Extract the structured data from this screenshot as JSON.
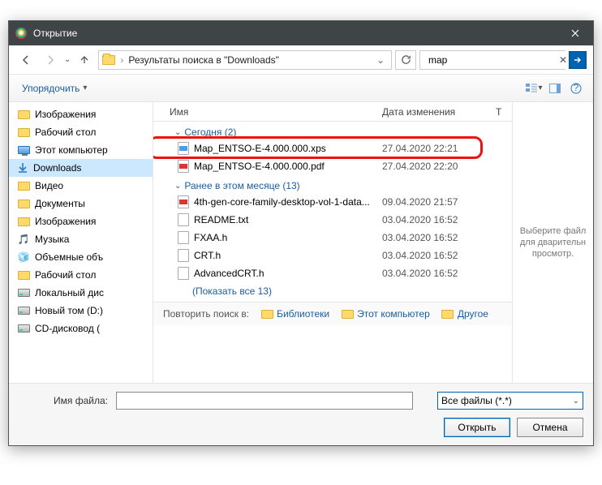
{
  "title": "Открытие",
  "breadcrumb": "Результаты поиска в \"Downloads\"",
  "search": {
    "value": "map"
  },
  "toolbar": {
    "organize": "Упорядочить"
  },
  "columns": {
    "name": "Имя",
    "date": "Дата изменения",
    "t": "Т"
  },
  "sidebar": {
    "items": [
      {
        "label": "Изображения",
        "icon": "folder"
      },
      {
        "label": "Рабочий стол",
        "icon": "folder"
      },
      {
        "label": "Этот компьютер",
        "icon": "pc"
      },
      {
        "label": "Downloads",
        "icon": "download",
        "selected": true
      },
      {
        "label": "Видео",
        "icon": "folder"
      },
      {
        "label": "Документы",
        "icon": "folder"
      },
      {
        "label": "Изображения",
        "icon": "folder"
      },
      {
        "label": "Музыка",
        "icon": "music"
      },
      {
        "label": "Объемные объ",
        "icon": "cube"
      },
      {
        "label": "Рабочий стол",
        "icon": "folder"
      },
      {
        "label": "Локальный дис",
        "icon": "disk"
      },
      {
        "label": "Новый том (D:)",
        "icon": "disk"
      },
      {
        "label": "CD-дисковод (",
        "icon": "disk"
      }
    ]
  },
  "groups": [
    {
      "label": "Сегодня (2)",
      "files": [
        {
          "name": "Map_ENTSO-E-4.000.000.xps",
          "date": "27.04.2020 22:21",
          "type": "xps",
          "highlight": true
        },
        {
          "name": "Map_ENTSO-E-4.000.000.pdf",
          "date": "27.04.2020 22:20",
          "type": "pdf"
        }
      ]
    },
    {
      "label": "Ранее в этом месяце (13)",
      "files": [
        {
          "name": "4th-gen-core-family-desktop-vol-1-data...",
          "date": "09.04.2020 21:57",
          "type": "pdf"
        },
        {
          "name": "README.txt",
          "date": "03.04.2020 16:52",
          "type": "txt"
        },
        {
          "name": "FXAA.h",
          "date": "03.04.2020 16:52",
          "type": "txt"
        },
        {
          "name": "CRT.h",
          "date": "03.04.2020 16:52",
          "type": "txt"
        },
        {
          "name": "AdvancedCRT.h",
          "date": "03.04.2020 16:52",
          "type": "txt"
        }
      ],
      "showall": "(Показать все 13)"
    }
  ],
  "repeat": {
    "label": "Повторить поиск в:",
    "locs": [
      "Библиотеки",
      "Этот компьютер",
      "Другое"
    ]
  },
  "preview": "Выберите файл для дварительн просмотр.",
  "footer": {
    "filename_label": "Имя файла:",
    "filename_value": "",
    "filter": "Все файлы (*.*)",
    "open": "Открыть",
    "cancel": "Отмена"
  }
}
